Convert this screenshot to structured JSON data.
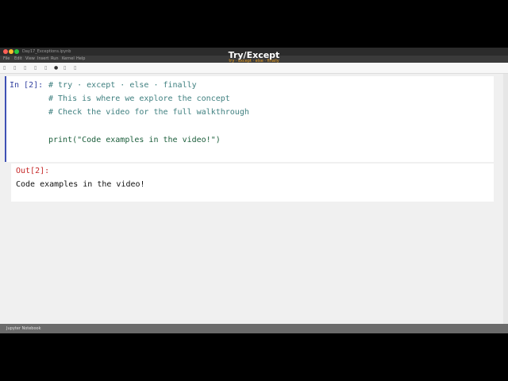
{
  "window": {
    "title": "Day17_Exceptions.ipynb"
  },
  "menu": [
    "File",
    "Edit",
    "View",
    "Insert",
    "Run",
    "Kernel",
    "Help"
  ],
  "video": {
    "title": "Try/Except",
    "subtitle": "try · except · else · finally"
  },
  "toolbar": {
    "icons": [
      "save-icon",
      "add-cell-icon",
      "cut-icon",
      "copy-icon",
      "paste-icon",
      "run-icon",
      "stop-icon",
      "restart-icon"
    ]
  },
  "cell_input": {
    "prompt": "In [2]:",
    "lines": [
      "# try · except · else · finally",
      "# This is where we explore the concept",
      "# Check the video for the full walkthrough",
      "",
      "print(\"Code examples in the video!\")"
    ]
  },
  "cell_output": {
    "prompt": "Out[2]:",
    "text": "Code examples in the video!"
  },
  "status": {
    "text": "Jupyter Notebook"
  },
  "colors": {
    "active_cell_border": "#3f51b5",
    "in_prompt": "#303f9f",
    "out_prompt": "#c62828",
    "comment": "#408080",
    "subtitle": "#f5a623"
  }
}
